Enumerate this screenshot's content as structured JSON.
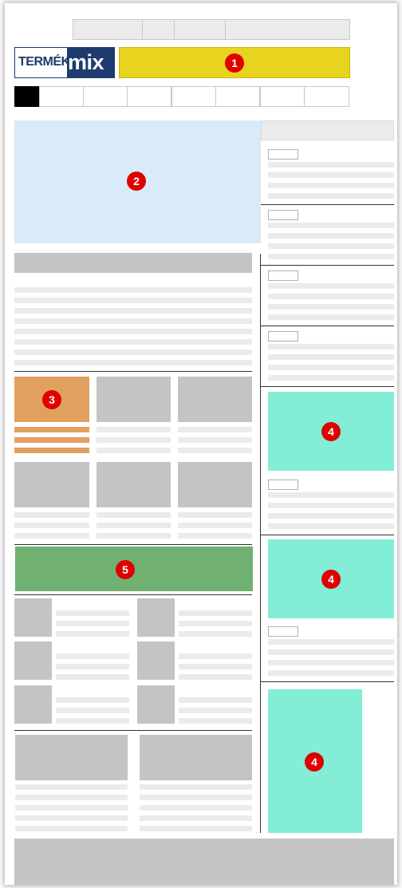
{
  "logo": {
    "text_left": "TERMÉK",
    "text_right": "mix"
  },
  "badges": {
    "leaderboard": "1",
    "hero": "2",
    "featured_thumb": "3",
    "sidebar_ad_1": "4",
    "sidebar_ad_2": "4",
    "sidebar_ad_3": "4",
    "banner": "5"
  },
  "colors": {
    "leaderboard": "#e8d41e",
    "hero": "#d9eaf8",
    "featured": "#e2a060",
    "sidebar_ad": "#84edd6",
    "banner": "#70b070",
    "logo_dark": "#1d3b6e"
  }
}
